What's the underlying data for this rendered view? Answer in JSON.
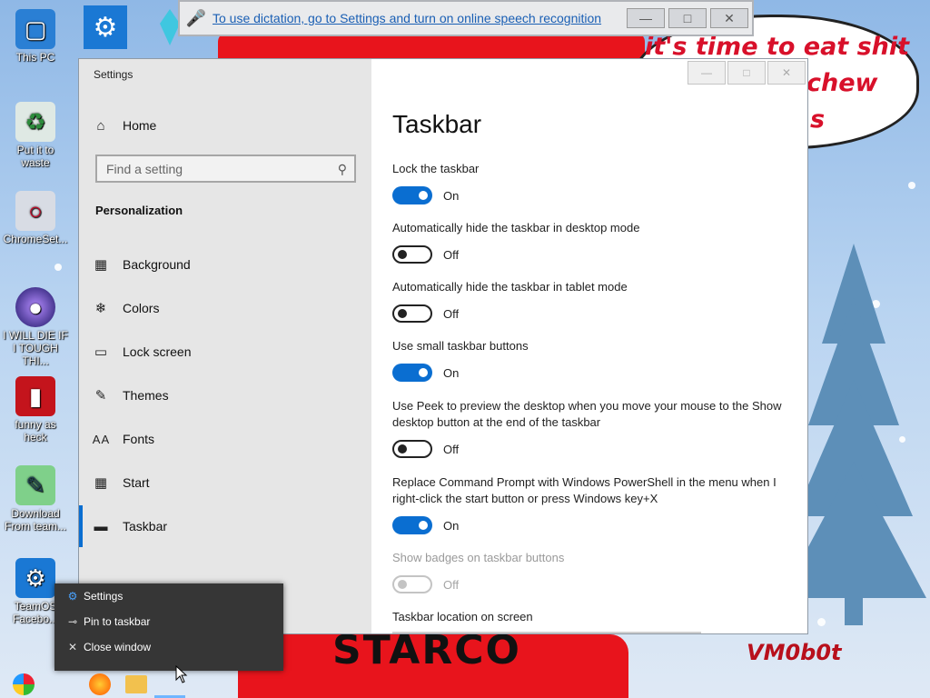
{
  "dictation": {
    "message": "To use dictation, go to Settings and turn on online speech recognition"
  },
  "desktop": {
    "icons": [
      {
        "label": "This PC"
      },
      {
        "label": "Put it to waste"
      },
      {
        "label": "ChromeSet..."
      },
      {
        "label": "I WILL DIE IF I TOUGH THI..."
      },
      {
        "label": "funny as heck"
      },
      {
        "label": "Download From team..."
      },
      {
        "label": "TeamOS Facebo..."
      }
    ],
    "bubble_line1": "it's time to eat shit",
    "bubble_line2": "chew",
    "bubble_line3": "s",
    "banner": "STARCO",
    "signature": "VM0b0t"
  },
  "settings": {
    "window_title": "Settings",
    "search_placeholder": "Find a setting",
    "home_label": "Home",
    "section_title": "Personalization",
    "nav": [
      {
        "label": "Background"
      },
      {
        "label": "Colors"
      },
      {
        "label": "Lock screen"
      },
      {
        "label": "Themes"
      },
      {
        "label": "Fonts"
      },
      {
        "label": "Start"
      },
      {
        "label": "Taskbar"
      }
    ],
    "page_title": "Taskbar",
    "options": [
      {
        "label": "Lock the taskbar",
        "state": "On"
      },
      {
        "label": "Automatically hide the taskbar in desktop mode",
        "state": "Off"
      },
      {
        "label": "Automatically hide the taskbar in tablet mode",
        "state": "Off"
      },
      {
        "label": "Use small taskbar buttons",
        "state": "On"
      },
      {
        "label": "Use Peek to preview the desktop when you move your mouse to the Show desktop button at the end of the taskbar",
        "state": "Off"
      },
      {
        "label": "Replace Command Prompt with Windows PowerShell in the menu when I right-click the start button or press Windows key+X",
        "state": "On"
      },
      {
        "label": "Show badges on taskbar buttons",
        "state": "Off"
      }
    ],
    "location_label": "Taskbar location on screen"
  },
  "jumplist": {
    "items": [
      {
        "label": "Settings"
      },
      {
        "label": "Pin to taskbar"
      },
      {
        "label": "Close window"
      }
    ]
  },
  "colors": {
    "accent": "#0a6ed1"
  }
}
